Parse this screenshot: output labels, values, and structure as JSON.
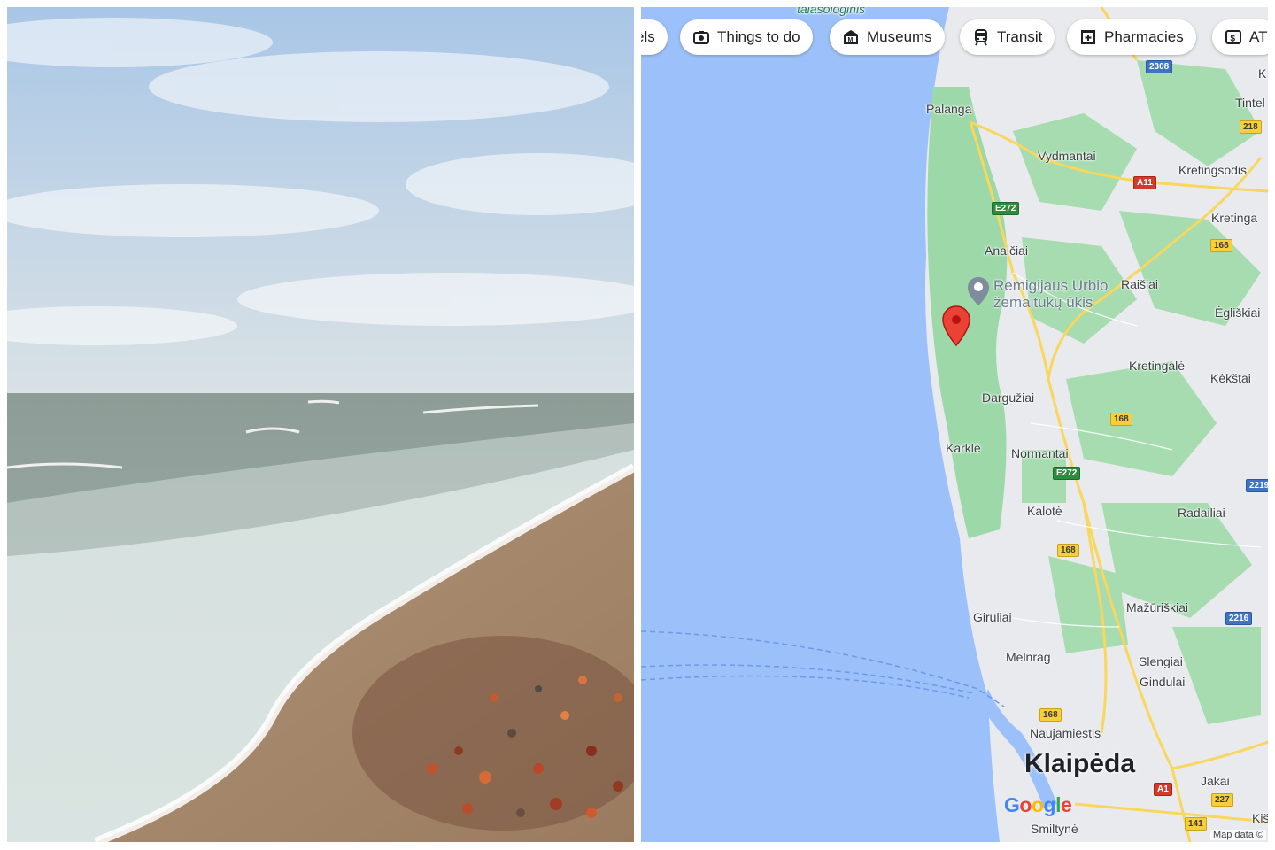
{
  "map": {
    "chips": [
      {
        "label": "els",
        "icon": "hotel-icon"
      },
      {
        "label": "Things to do",
        "icon": "camera-icon"
      },
      {
        "label": "Museums",
        "icon": "museum-icon"
      },
      {
        "label": "Transit",
        "icon": "train-icon"
      },
      {
        "label": "Pharmacies",
        "icon": "pharmacy-icon"
      },
      {
        "label": "AT",
        "icon": "atm-icon"
      }
    ],
    "places": {
      "top_cut": "talasologinis",
      "palanga": "Palanga",
      "vydmantai": "Vydmantai",
      "kretingsodis": "Kretingsodis",
      "kretinga": "Kretinga",
      "tintel": "Tintel",
      "k_edge": "K",
      "anaiciai": "Anaičiai",
      "raisiai": "Raišiai",
      "egliskiai": "Ėgliškiai",
      "kretingale": "Kretingalė",
      "kekstai": "Kėkštai",
      "darguziai": "Dargužiai",
      "karkle": "Karklė",
      "normantai": "Normantai",
      "kalote": "Kalotė",
      "radailiai": "Radailiai",
      "giruliai": "Giruliai",
      "mazuriskiai": "Mažūriškiai",
      "melnrag": "Melnrag",
      "slengiai": "Slengiai",
      "gindulai": "Gindulai",
      "naujamiestis": "Naujamiestis",
      "jakai": "Jakai",
      "smiltyne": "Smiltynė",
      "kis": "Kiš"
    },
    "city": "Klaipėda",
    "poi": {
      "line1": "Remigijaus Urbio",
      "line2": "žemaitukų ūkis"
    },
    "shields": {
      "r2308": "2308",
      "r218": "218",
      "a11": "A11",
      "e272a": "E272",
      "r168a": "168",
      "r168b": "168",
      "e272b": "E272",
      "r2219": "2219",
      "r168c": "168",
      "r2216": "2216",
      "r168d": "168",
      "a1": "A1",
      "r227": "227",
      "r141": "141"
    },
    "google_logo": "Google",
    "attribution": "Map data ©",
    "colors": {
      "water": "#9cc0f9",
      "land": "#e8eaed",
      "forest": "#9dd8a8",
      "highway": "#f9d65c",
      "pin": "#ea4335"
    }
  }
}
